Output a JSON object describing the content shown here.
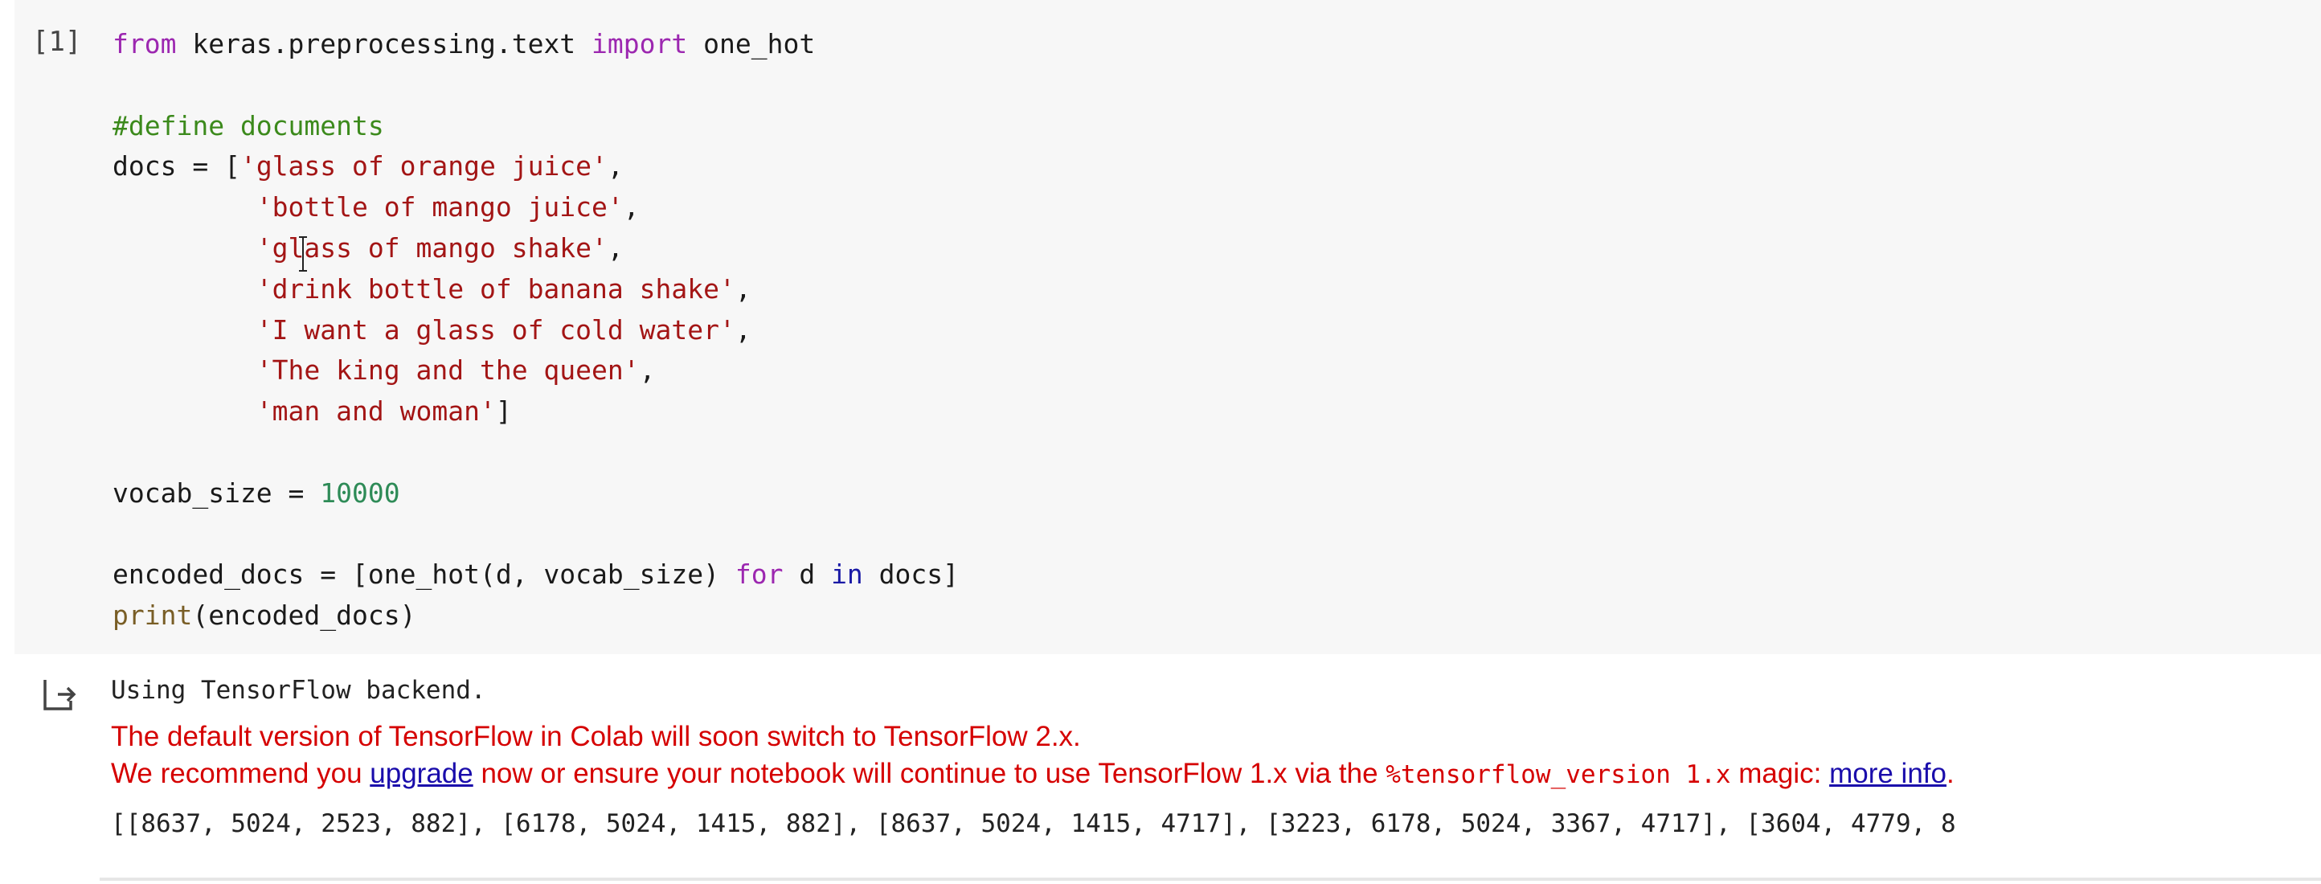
{
  "cell": {
    "execution_count": "[1]",
    "code_lines": [
      [
        {
          "t": "from",
          "c": "kw"
        },
        {
          "t": " keras.preprocessing.text "
        },
        {
          "t": "import",
          "c": "kw"
        },
        {
          "t": " one_hot"
        }
      ],
      [],
      [
        {
          "t": "#define documents",
          "c": "cm"
        }
      ],
      [
        {
          "t": "docs = ["
        },
        {
          "t": "'glass of orange juice'",
          "c": "st"
        },
        {
          "t": ","
        }
      ],
      [
        {
          "t": "         "
        },
        {
          "t": "'bottle of mango juice'",
          "c": "st"
        },
        {
          "t": ","
        }
      ],
      [
        {
          "t": "         "
        },
        {
          "t": "'glass of mango shake'",
          "c": "st"
        },
        {
          "t": ","
        }
      ],
      [
        {
          "t": "         "
        },
        {
          "t": "'drink bottle of banana shake'",
          "c": "st"
        },
        {
          "t": ","
        }
      ],
      [
        {
          "t": "         "
        },
        {
          "t": "'I want a glass of cold water'",
          "c": "st"
        },
        {
          "t": ","
        }
      ],
      [
        {
          "t": "         "
        },
        {
          "t": "'The king and the queen'",
          "c": "st"
        },
        {
          "t": ","
        }
      ],
      [
        {
          "t": "         "
        },
        {
          "t": "'man and woman'",
          "c": "st"
        },
        {
          "t": "]"
        }
      ],
      [],
      [
        {
          "t": "vocab_size = "
        },
        {
          "t": "10000",
          "c": "nm"
        }
      ],
      [],
      [
        {
          "t": "encoded_docs = [one_hot(d, vocab_size) "
        },
        {
          "t": "for",
          "c": "kw"
        },
        {
          "t": " d "
        },
        {
          "t": "in",
          "c": "kw2"
        },
        {
          "t": " docs]"
        }
      ],
      [
        {
          "t": "print",
          "c": "bi"
        },
        {
          "t": "(encoded_docs)"
        }
      ]
    ]
  },
  "output": {
    "icon": "output-arrow-icon",
    "backend_line": "Using TensorFlow backend.",
    "warning_line1": "The default version of TensorFlow in Colab will soon switch to TensorFlow 2.x.",
    "warning_line2_prefix": "We recommend you ",
    "upgrade_link": "upgrade",
    "warning_line2_mid": " now or ensure your notebook will continue to use TensorFlow 1.x via the ",
    "magic_code": "%tensorflow_version 1.x",
    "warning_line2_suffix": " magic: ",
    "more_info_link": "more info",
    "warning_line2_end": ".",
    "result_line": "[[8637, 5024, 2523, 882], [6178, 5024, 1415, 882], [8637, 5024, 1415, 4717], [3223, 6178, 5024, 3367, 4717], [3604, 4779, 8"
  },
  "colors": {
    "keyword": "#9c27b0",
    "comment": "#3c8a1c",
    "string": "#a31515",
    "number": "#2e8b57",
    "warning": "#d50000",
    "link": "#1a0dab"
  }
}
